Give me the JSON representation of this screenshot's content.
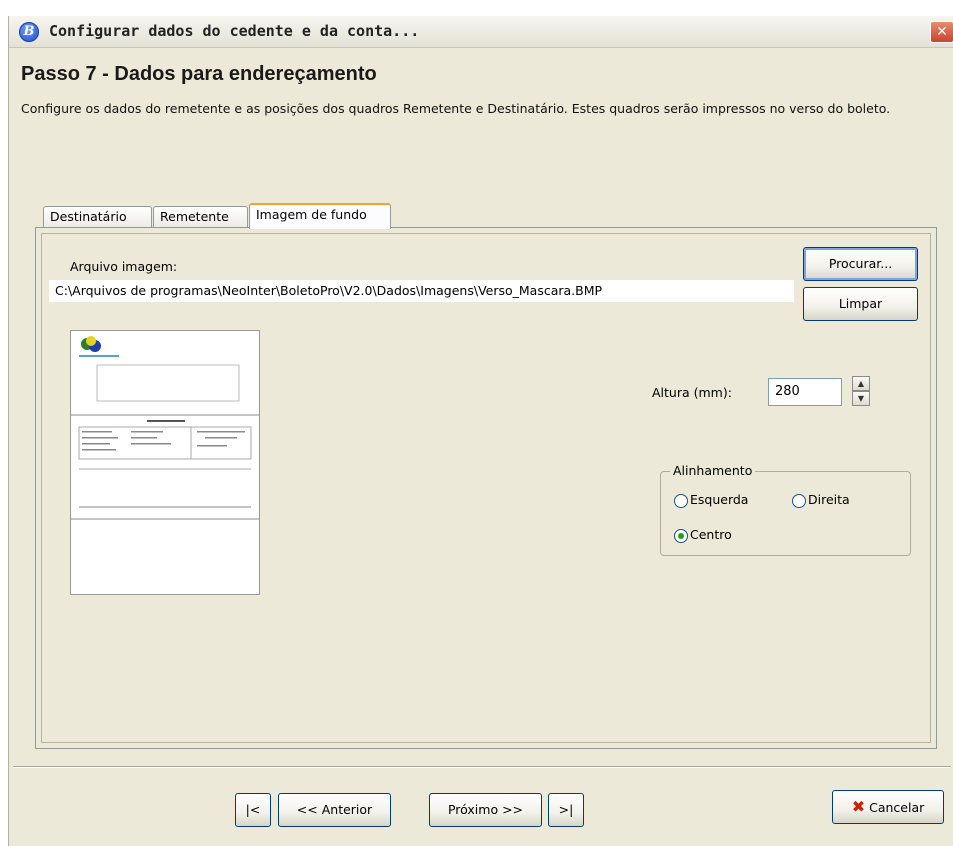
{
  "window": {
    "title": "Configurar dados do cedente e da conta...",
    "app_icon_letter": "B",
    "close_glyph": "✕"
  },
  "header": {
    "step_title": "Passo 7 - Dados para endereçamento",
    "description": "Configure os dados do remetente e as posições dos quadros Remetente e Destinatário. Estes quadros serão impressos no verso do boleto."
  },
  "tabs": [
    {
      "label": "Destinatário",
      "active": false
    },
    {
      "label": "Remetente",
      "active": false
    },
    {
      "label": "Imagem de fundo",
      "active": true
    }
  ],
  "image_tab": {
    "file_label": "Arquivo imagem:",
    "file_path": "C:\\Arquivos de programas\\NeoInter\\BoletoPro\\V2.0\\Dados\\Imagens\\Verso_Mascara.BMP",
    "browse_button": "Procurar...",
    "clear_button": "Limpar",
    "height_label": "Altura (mm):",
    "height_value": "280",
    "alignment": {
      "legend": "Alinhamento",
      "options": [
        "Esquerda",
        "Direita",
        "Centro"
      ],
      "selected": "Centro"
    }
  },
  "footer": {
    "first_button": "|<",
    "prev_button": "<< Anterior",
    "next_button": "Próximo >>",
    "last_button": ">|",
    "cancel_button": "Cancelar",
    "cancel_icon": "✖"
  },
  "colors": {
    "window_bg": "#ece9d8",
    "tab_active_accent": "#f0a430",
    "button_border": "#003c74",
    "radio_checked": "#21a121",
    "cancel_icon": "#cc2200"
  }
}
